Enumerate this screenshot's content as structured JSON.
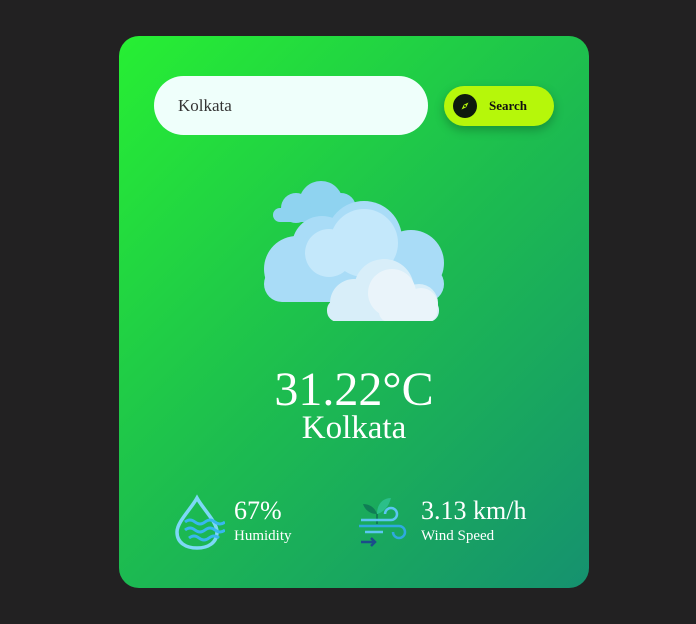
{
  "search": {
    "value": "Kolkata",
    "button_label": "Search",
    "button_icon": "compass-icon"
  },
  "weather": {
    "condition_icon": "clouds-icon",
    "temperature": "31.22°C",
    "city": "Kolkata"
  },
  "humidity": {
    "icon": "humidity-icon",
    "value": "67%",
    "label": "Humidity"
  },
  "wind": {
    "icon": "wind-icon",
    "value": "3.13 km/h",
    "label": "Wind Speed"
  },
  "colors": {
    "page_background": "#222122",
    "card_gradient_start": "#27ef33",
    "card_gradient_end": "#15916f",
    "search_input_bg": "#effffb",
    "search_button_bg": "#b6f70a",
    "text": "#ffffff"
  }
}
